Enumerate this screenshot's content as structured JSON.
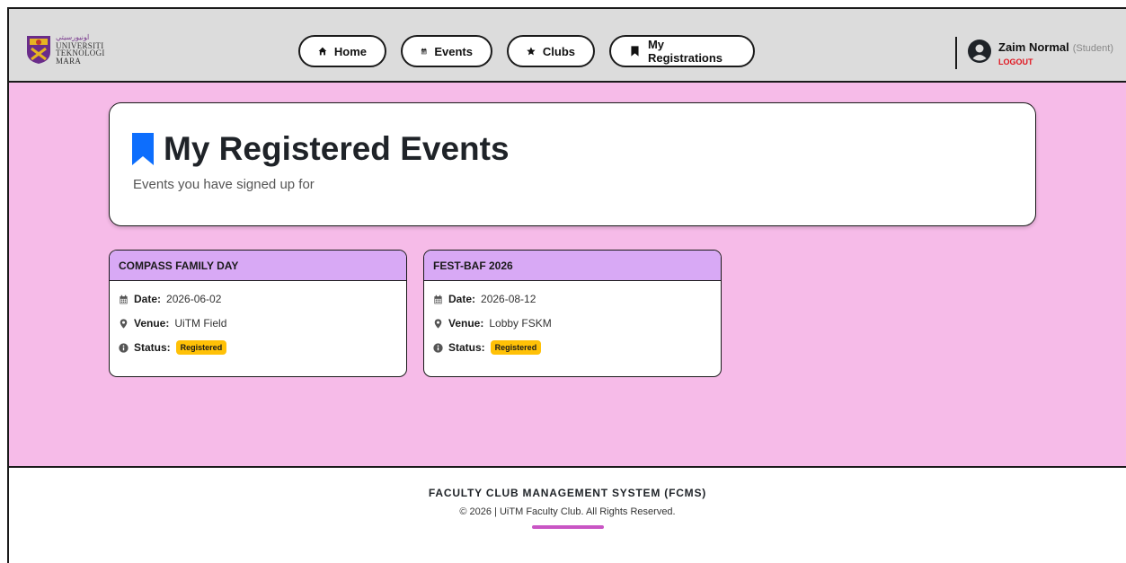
{
  "header": {
    "logo": {
      "name": "UiTM logo",
      "line1": "UNIVERSITI",
      "line2": "TEKNOLOGI",
      "line3": "MARA"
    },
    "nav": [
      {
        "label": "Home",
        "icon": "home-icon"
      },
      {
        "label": "Events",
        "icon": "calendar-icon"
      },
      {
        "label": "Clubs",
        "icon": "star-icon"
      },
      {
        "label": "My Registrations",
        "icon": "bookmark-icon"
      }
    ],
    "user": {
      "name": "Zaim Normal",
      "role": "(Student)",
      "logout": "LOGOUT"
    }
  },
  "page": {
    "title": "My Registered Events",
    "subtitle": "Events you have signed up for"
  },
  "labels": {
    "date": "Date:",
    "venue": "Venue:",
    "status": "Status:"
  },
  "events": [
    {
      "title": "COMPASS FAMILY DAY",
      "date": "2026-06-02",
      "venue": "UiTM Field",
      "status": "Registered"
    },
    {
      "title": "FEST-BAF 2026",
      "date": "2026-08-12",
      "venue": "Lobby FSKM",
      "status": "Registered"
    }
  ],
  "footer": {
    "title": "FACULTY CLUB MANAGEMENT SYSTEM (FCMS)",
    "copyright": "© 2026 | UiTM Faculty Club. All Rights Reserved."
  },
  "colors": {
    "background": "#f6bbe8",
    "card_header": "#d8a9f5",
    "accent_blue": "#0d6efd",
    "logout_red": "#e0141e",
    "badge_yellow": "#ffc107",
    "footer_bar": "#c955c4"
  }
}
